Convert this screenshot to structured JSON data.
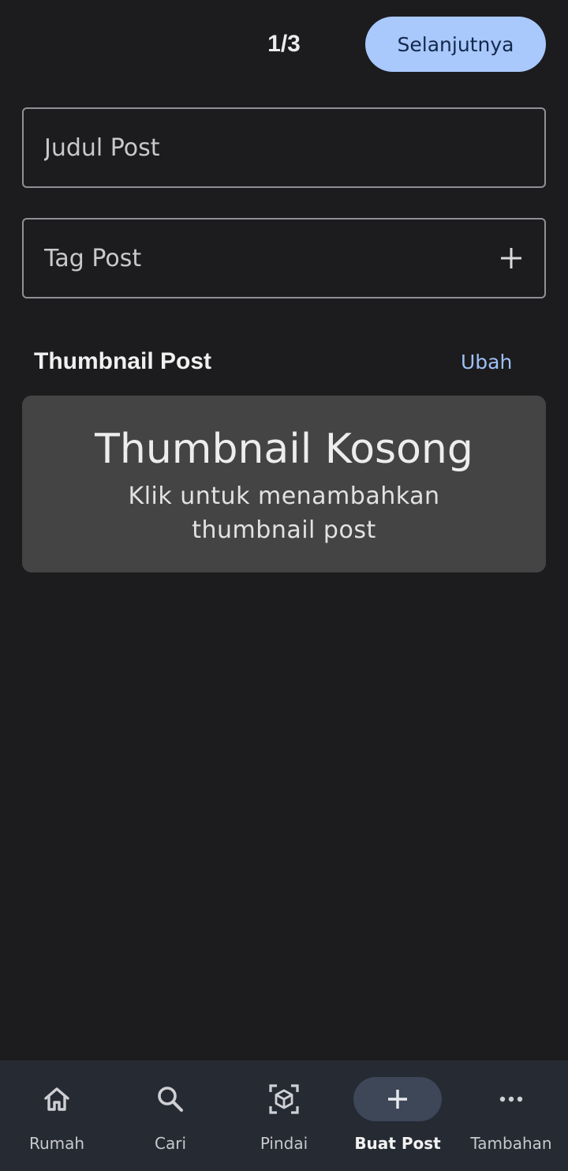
{
  "header": {
    "step": "1/3",
    "next_label": "Selanjutnya"
  },
  "form": {
    "title_placeholder": "Judul Post",
    "tag_placeholder": "Tag Post"
  },
  "thumbnail": {
    "section_title": "Thumbnail Post",
    "change_label": "Ubah",
    "empty_heading": "Thumbnail Kosong",
    "empty_hint": "Klik untuk menambahkan thumbnail post"
  },
  "bottom_nav": {
    "active": "Buat Post",
    "items": [
      {
        "label": "Rumah",
        "icon": "home-icon"
      },
      {
        "label": "Cari",
        "icon": "search-icon"
      },
      {
        "label": "Pindai",
        "icon": "scan-icon"
      },
      {
        "label": "Buat Post",
        "icon": "plus-icon"
      },
      {
        "label": "Tambahan",
        "icon": "more-icon"
      }
    ]
  },
  "colors": {
    "background": "#1c1c1e",
    "accent": "#a9c8fb",
    "link": "#9ec0f5",
    "nav_background": "#262a33",
    "active_pill": "#3d4758"
  }
}
